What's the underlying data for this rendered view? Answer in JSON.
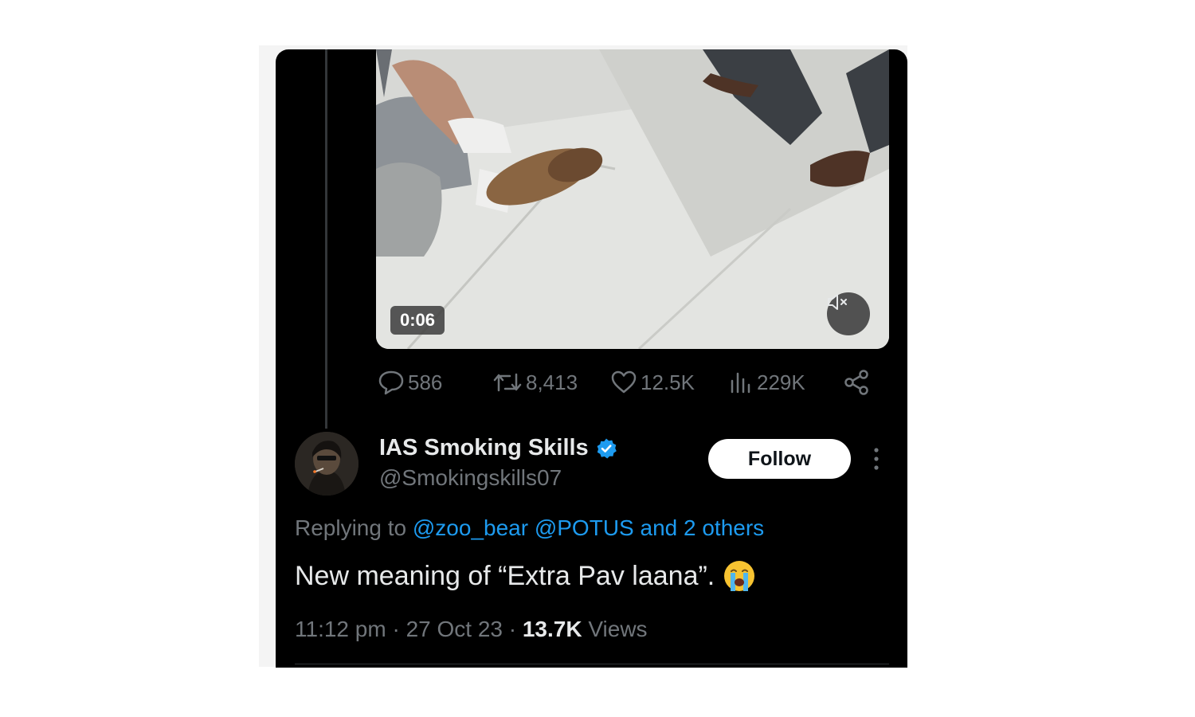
{
  "media": {
    "duration": "0:06",
    "mute_icon": "speaker-muted-icon"
  },
  "actions": [
    {
      "icon": "reply-icon",
      "count": "586"
    },
    {
      "icon": "retweet-icon",
      "count": "8,413"
    },
    {
      "icon": "like-icon",
      "count": "12.5K"
    },
    {
      "icon": "views-icon",
      "count": "229K"
    },
    {
      "icon": "share-icon"
    }
  ],
  "author": {
    "name": "IAS Smoking Skills",
    "handle": "@Smokingskills07",
    "verified": true
  },
  "follow_label": "Follow",
  "reply": {
    "prefix": "Replying to",
    "mentions": "@zoo_bear @POTUS and 2 others"
  },
  "tweet": {
    "text": "New meaning of “Extra Pav laana”.",
    "emoji": "loudly-crying-face"
  },
  "meta": {
    "time": "11:12 pm",
    "sep": "·",
    "date": "27 Oct 23",
    "views_count": "13.7K",
    "views_label": "Views"
  },
  "colors": {
    "background": "#000000",
    "text": "#e7e9ea",
    "muted": "#71767b",
    "link": "#1d9bf0",
    "verified": "#1d9bf0"
  }
}
